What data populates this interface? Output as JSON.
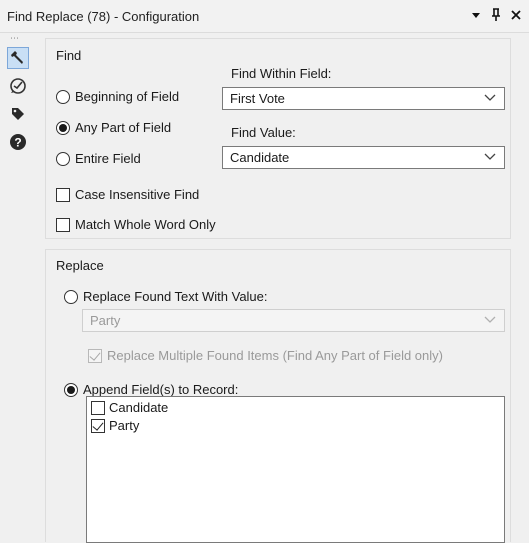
{
  "window": {
    "title": "Find Replace (78) - Configuration",
    "icons": [
      "dropdown-arrow-icon",
      "pin-icon",
      "close-icon"
    ]
  },
  "toolstrip": {
    "items": [
      {
        "name": "configuration-wrench-icon",
        "active": true
      },
      {
        "name": "annotation-icon",
        "active": false
      },
      {
        "name": "tag-icon",
        "active": false
      },
      {
        "name": "help-icon",
        "active": false
      }
    ]
  },
  "find": {
    "group_label": "Find",
    "options": [
      "Beginning of Field",
      "Any Part of Field",
      "Entire Field"
    ],
    "selected_option": "Any Part of Field",
    "within_field_label": "Find Within Field:",
    "within_field_value": "First Vote",
    "find_value_label": "Find Value:",
    "find_value": "Candidate",
    "case_insensitive_label": "Case Insensitive Find",
    "case_insensitive_checked": false,
    "whole_word_label": "Match Whole Word Only",
    "whole_word_checked": false
  },
  "replace": {
    "group_label": "Replace",
    "replace_text_label": "Replace Found Text With Value:",
    "replace_text_selected": false,
    "replace_value": "Party",
    "replace_multiple_label": "Replace Multiple Found Items (Find Any Part of Field only)",
    "replace_multiple_checked": true,
    "append_label": "Append Field(s) to Record:",
    "append_selected": true,
    "append_fields": [
      {
        "label": "Candidate",
        "checked": false
      },
      {
        "label": "Party",
        "checked": true
      }
    ]
  }
}
